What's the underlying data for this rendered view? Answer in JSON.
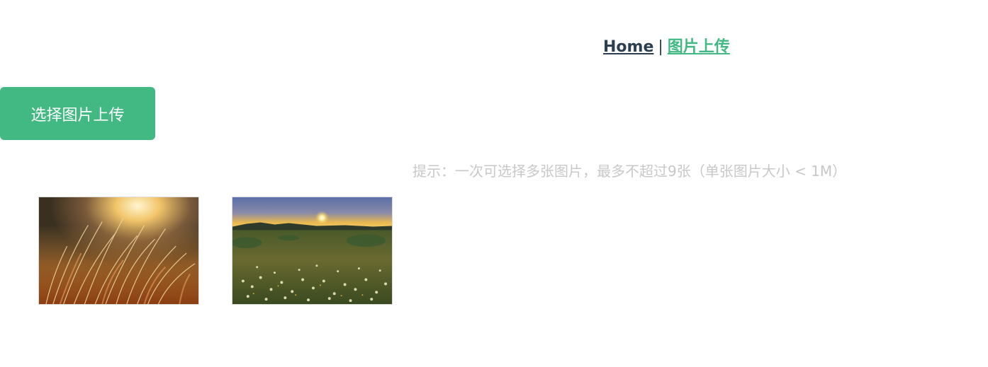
{
  "nav": {
    "home_label": "Home",
    "separator": "|",
    "upload_label": "图片上传",
    "active_color": "#42b983",
    "link_color": "#2c3e50"
  },
  "upload": {
    "button_label": "选择图片上传",
    "button_color": "#42b983",
    "hint": "提示：一次可选择多张图片，最多不超过9张（单张图片大小 < 1M）"
  },
  "images": [
    {
      "name": "wheat-grass-sunset-photo"
    },
    {
      "name": "flower-field-sunrise-photo"
    }
  ]
}
